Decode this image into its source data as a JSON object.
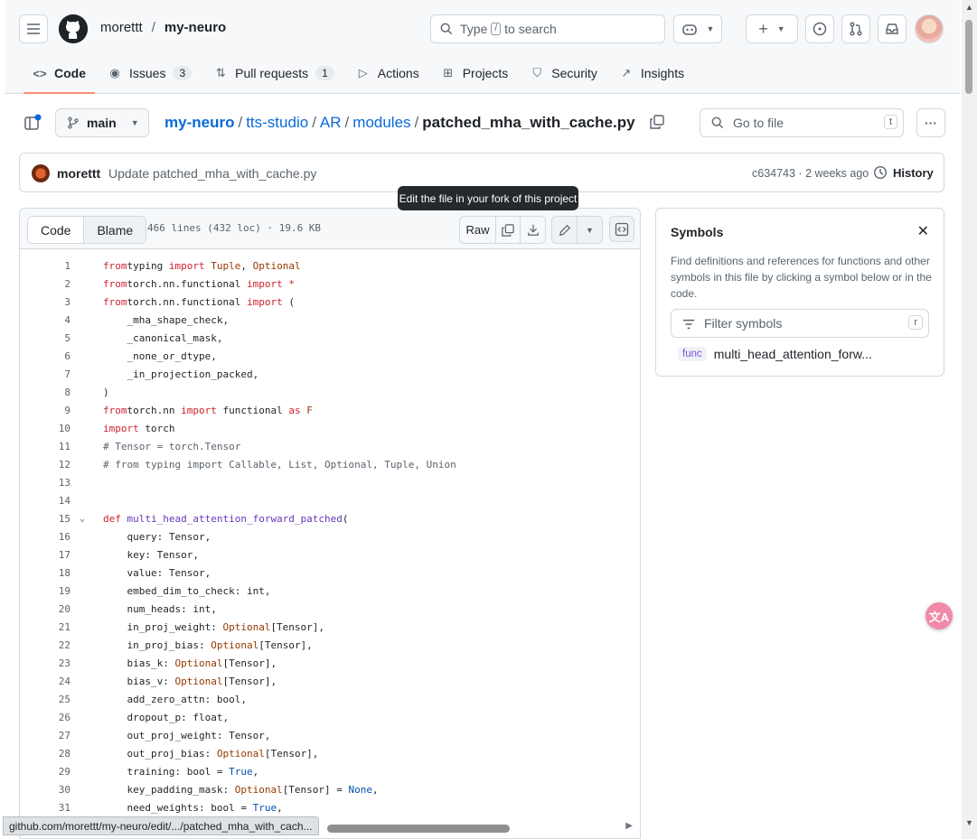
{
  "header": {
    "owner": "morettt",
    "separator": "/",
    "repo": "my-neuro",
    "search": {
      "prefix": "Type",
      "key": "/",
      "suffix": "to search"
    }
  },
  "tabs": [
    {
      "label": "Code",
      "icon": "code-icon",
      "count": ""
    },
    {
      "label": "Issues",
      "icon": "issue-icon",
      "count": "3"
    },
    {
      "label": "Pull requests",
      "icon": "pull-request-icon",
      "count": "1"
    },
    {
      "label": "Actions",
      "icon": "play-icon",
      "count": ""
    },
    {
      "label": "Projects",
      "icon": "table-icon",
      "count": ""
    },
    {
      "label": "Security",
      "icon": "shield-icon",
      "count": ""
    },
    {
      "label": "Insights",
      "icon": "graph-icon",
      "count": ""
    }
  ],
  "breadcrumb": {
    "branch": "main",
    "parts": [
      "my-neuro",
      "tts-studio",
      "AR",
      "modules"
    ],
    "file": "patched_mha_with_cache.py",
    "goto_placeholder": "Go to file",
    "goto_key": "t"
  },
  "commit": {
    "author": "morettt",
    "message": "Update patched_mha_with_cache.py",
    "meta": "c634743 · 2 weeks ago",
    "history": "History"
  },
  "tooltip": "Edit the file in your fork of this project",
  "codebar": {
    "code_tab": "Code",
    "blame_tab": "Blame",
    "info": "466 lines (432 loc) · 19.6 KB",
    "raw": "Raw"
  },
  "symbols": {
    "title": "Symbols",
    "description": "Find definitions and references for functions and other symbols in this file by clicking a symbol below or in the code.",
    "filter_placeholder": "Filter symbols",
    "filter_key": "r",
    "items": [
      {
        "kind": "func",
        "name": "multi_head_attention_forw..."
      }
    ]
  },
  "code_lines": [
    {
      "n": "1",
      "tokens": [
        [
          "kw",
          "from"
        ],
        [
          "",
          "typing "
        ],
        [
          "kw",
          "import"
        ],
        [
          "ty",
          " Tuple"
        ],
        [
          "",
          ", "
        ],
        [
          "ty",
          "Optional"
        ]
      ]
    },
    {
      "n": "2",
      "tokens": [
        [
          "kw",
          "from"
        ],
        [
          "",
          "torch.nn.functional "
        ],
        [
          "kw",
          "import"
        ],
        [
          "",
          " "
        ],
        [
          "kw",
          "*"
        ]
      ]
    },
    {
      "n": "3",
      "tokens": [
        [
          "kw",
          "from"
        ],
        [
          "",
          "torch.nn.functional "
        ],
        [
          "kw",
          "import"
        ],
        [
          "",
          " ("
        ]
      ]
    },
    {
      "n": "4",
      "tokens": [
        [
          "",
          "    _mha_shape_check,"
        ]
      ]
    },
    {
      "n": "5",
      "tokens": [
        [
          "",
          "    _canonical_mask,"
        ]
      ]
    },
    {
      "n": "6",
      "tokens": [
        [
          "",
          "    _none_or_dtype,"
        ]
      ]
    },
    {
      "n": "7",
      "tokens": [
        [
          "",
          "    _in_projection_packed,"
        ]
      ]
    },
    {
      "n": "8",
      "tokens": [
        [
          "",
          ")"
        ]
      ]
    },
    {
      "n": "9",
      "tokens": [
        [
          "kw",
          "from"
        ],
        [
          "",
          "torch.nn "
        ],
        [
          "kw",
          "import"
        ],
        [
          "",
          " functional "
        ],
        [
          "kw",
          "as"
        ],
        [
          "",
          " "
        ],
        [
          "ty",
          "F"
        ]
      ]
    },
    {
      "n": "10",
      "tokens": [
        [
          "kw",
          "import"
        ],
        [
          "",
          " torch"
        ]
      ]
    },
    {
      "n": "11",
      "tokens": [
        [
          "cm",
          "# Tensor = torch.Tensor"
        ]
      ]
    },
    {
      "n": "12",
      "tokens": [
        [
          "cm",
          "# from typing import Callable, List, Optional, Tuple, Union"
        ]
      ]
    },
    {
      "n": "13",
      "tokens": []
    },
    {
      "n": "14",
      "tokens": []
    },
    {
      "n": "15",
      "tokens": [
        [
          "kw",
          "def"
        ],
        [
          "",
          " "
        ],
        [
          "fn",
          "multi_head_attention_forward_patched"
        ],
        [
          "",
          "("
        ]
      ],
      "fold": true
    },
    {
      "n": "16",
      "tokens": [
        [
          "",
          "    query: Tensor,"
        ]
      ]
    },
    {
      "n": "17",
      "tokens": [
        [
          "",
          "    key: Tensor,"
        ]
      ]
    },
    {
      "n": "18",
      "tokens": [
        [
          "",
          "    value: Tensor,"
        ]
      ]
    },
    {
      "n": "19",
      "tokens": [
        [
          "",
          "    embed_dim_to_check: int,"
        ]
      ]
    },
    {
      "n": "20",
      "tokens": [
        [
          "",
          "    num_heads: int,"
        ]
      ]
    },
    {
      "n": "21",
      "tokens": [
        [
          "",
          "    in_proj_weight: "
        ],
        [
          "ty",
          "Optional"
        ],
        [
          "",
          "[Tensor],"
        ]
      ]
    },
    {
      "n": "22",
      "tokens": [
        [
          "",
          "    in_proj_bias: "
        ],
        [
          "ty",
          "Optional"
        ],
        [
          "",
          "[Tensor],"
        ]
      ]
    },
    {
      "n": "23",
      "tokens": [
        [
          "",
          "    bias_k: "
        ],
        [
          "ty",
          "Optional"
        ],
        [
          "",
          "[Tensor],"
        ]
      ]
    },
    {
      "n": "24",
      "tokens": [
        [
          "",
          "    bias_v: "
        ],
        [
          "ty",
          "Optional"
        ],
        [
          "",
          "[Tensor],"
        ]
      ]
    },
    {
      "n": "25",
      "tokens": [
        [
          "",
          "    add_zero_attn: bool,"
        ]
      ]
    },
    {
      "n": "26",
      "tokens": [
        [
          "",
          "    dropout_p: float,"
        ]
      ]
    },
    {
      "n": "27",
      "tokens": [
        [
          "",
          "    out_proj_weight: Tensor,"
        ]
      ]
    },
    {
      "n": "28",
      "tokens": [
        [
          "",
          "    out_proj_bias: "
        ],
        [
          "ty",
          "Optional"
        ],
        [
          "",
          "[Tensor],"
        ]
      ]
    },
    {
      "n": "29",
      "tokens": [
        [
          "",
          "    training: bool = "
        ],
        [
          "cn",
          "True"
        ],
        [
          "",
          ","
        ]
      ]
    },
    {
      "n": "30",
      "tokens": [
        [
          "",
          "    key_padding_mask: "
        ],
        [
          "ty",
          "Optional"
        ],
        [
          "",
          "[Tensor] = "
        ],
        [
          "cn",
          "None"
        ],
        [
          "",
          ","
        ]
      ]
    },
    {
      "n": "31",
      "tokens": [
        [
          "",
          "    need_weights: bool = "
        ],
        [
          "cn",
          "True"
        ],
        [
          "",
          ","
        ]
      ]
    }
  ],
  "statusbar": "github.com/morettt/my-neuro/edit/.../patched_mha_with_cach...",
  "colors": {
    "accent": "#0969da",
    "active_tab_underline": "#fd8c73",
    "translate_button": "#f08aa8"
  }
}
